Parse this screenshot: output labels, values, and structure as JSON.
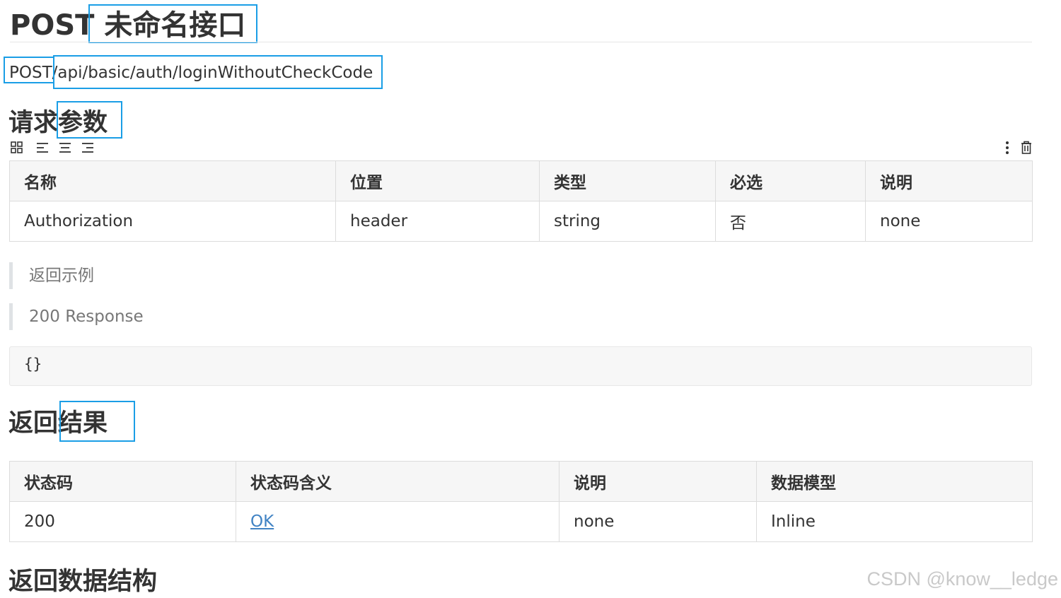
{
  "page": {
    "method": "POST",
    "title_name": "未命名接口"
  },
  "endpoint": {
    "method": "POST",
    "path": "/api/basic/auth/loginWithoutCheckCode"
  },
  "request_params": {
    "heading_prefix": "请求",
    "heading_suffix": "参数",
    "toolbar_icons": [
      "grid-icon",
      "align-left-icon",
      "align-center-icon",
      "align-right-icon",
      "more-vertical-icon",
      "trash-icon"
    ],
    "columns": [
      "名称",
      "位置",
      "类型",
      "必选",
      "说明"
    ],
    "rows": [
      [
        "Authorization",
        "header",
        "string",
        "否",
        "none"
      ]
    ]
  },
  "response_example": {
    "quote1": "返回示例",
    "quote2": "200 Response",
    "code": "{}"
  },
  "response_result": {
    "heading_prefix": "返回",
    "heading_suffix": "结果",
    "columns": [
      "状态码",
      "状态码含义",
      "说明",
      "数据模型"
    ],
    "rows": [
      [
        "200",
        "OK",
        "none",
        "Inline"
      ]
    ]
  },
  "response_structure": {
    "heading": "返回数据结构"
  },
  "watermark": "CSDN @know__ledge",
  "colors": {
    "highlight": "#1a9ee6",
    "link": "#4183c4",
    "header_bg": "#f6f6f6"
  }
}
